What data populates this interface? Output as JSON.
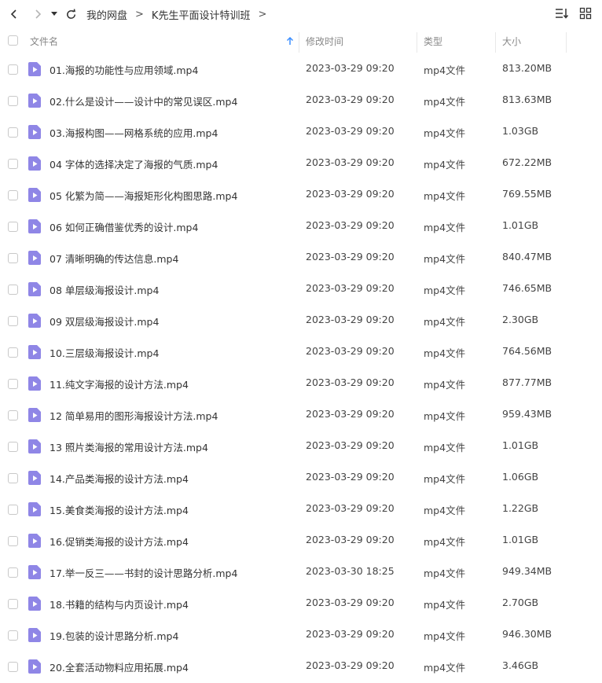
{
  "toolbar": {
    "breadcrumbs": [
      "我的网盘",
      "K先生平面设计特训班"
    ],
    "separator": ">"
  },
  "columns": {
    "name": "文件名",
    "modified": "修改时间",
    "type": "类型",
    "size": "大小"
  },
  "colors": {
    "file_icon": "#8f86e6",
    "sort_arrow": "#3d8fff"
  },
  "files": [
    {
      "name": "01.海报的功能性与应用领域.mp4",
      "modified": "2023-03-29 09:20",
      "type": "mp4文件",
      "size": "813.20MB"
    },
    {
      "name": "02.什么是设计——设计中的常见误区.mp4",
      "modified": "2023-03-29 09:20",
      "type": "mp4文件",
      "size": "813.63MB"
    },
    {
      "name": "03.海报构图——网格系统的应用.mp4",
      "modified": "2023-03-29 09:20",
      "type": "mp4文件",
      "size": "1.03GB"
    },
    {
      "name": "04 字体的选择决定了海报的气质.mp4",
      "modified": "2023-03-29 09:20",
      "type": "mp4文件",
      "size": "672.22MB"
    },
    {
      "name": "05 化繁为简——海报矩形化构图思路.mp4",
      "modified": "2023-03-29 09:20",
      "type": "mp4文件",
      "size": "769.55MB"
    },
    {
      "name": "06 如何正确借鉴优秀的设计.mp4",
      "modified": "2023-03-29 09:20",
      "type": "mp4文件",
      "size": "1.01GB"
    },
    {
      "name": "07 清晰明确的传达信息.mp4",
      "modified": "2023-03-29 09:20",
      "type": "mp4文件",
      "size": "840.47MB"
    },
    {
      "name": "08 单层级海报设计.mp4",
      "modified": "2023-03-29 09:20",
      "type": "mp4文件",
      "size": "746.65MB"
    },
    {
      "name": "09 双层级海报设计.mp4",
      "modified": "2023-03-29 09:20",
      "type": "mp4文件",
      "size": "2.30GB"
    },
    {
      "name": "10.三层级海报设计.mp4",
      "modified": "2023-03-29 09:20",
      "type": "mp4文件",
      "size": "764.56MB"
    },
    {
      "name": "11.纯文字海报的设计方法.mp4",
      "modified": "2023-03-29 09:20",
      "type": "mp4文件",
      "size": "877.77MB"
    },
    {
      "name": "12 简单易用的图形海报设计方法.mp4",
      "modified": "2023-03-29 09:20",
      "type": "mp4文件",
      "size": "959.43MB"
    },
    {
      "name": "13 照片类海报的常用设计方法.mp4",
      "modified": "2023-03-29 09:20",
      "type": "mp4文件",
      "size": "1.01GB"
    },
    {
      "name": "14.产品类海报的设计方法.mp4",
      "modified": "2023-03-29 09:20",
      "type": "mp4文件",
      "size": "1.06GB"
    },
    {
      "name": "15.美食类海报的设计方法.mp4",
      "modified": "2023-03-29 09:20",
      "type": "mp4文件",
      "size": "1.22GB"
    },
    {
      "name": "16.促销类海报的设计方法.mp4",
      "modified": "2023-03-29 09:20",
      "type": "mp4文件",
      "size": "1.01GB"
    },
    {
      "name": "17.举一反三——书封的设计思路分析.mp4",
      "modified": "2023-03-30 18:25",
      "type": "mp4文件",
      "size": "949.34MB"
    },
    {
      "name": "18.书籍的结构与内页设计.mp4",
      "modified": "2023-03-29 09:20",
      "type": "mp4文件",
      "size": "2.70GB"
    },
    {
      "name": "19.包装的设计思路分析.mp4",
      "modified": "2023-03-29 09:20",
      "type": "mp4文件",
      "size": "946.30MB"
    },
    {
      "name": "20.全套活动物料应用拓展.mp4",
      "modified": "2023-03-29 09:20",
      "type": "mp4文件",
      "size": "3.46GB"
    }
  ]
}
